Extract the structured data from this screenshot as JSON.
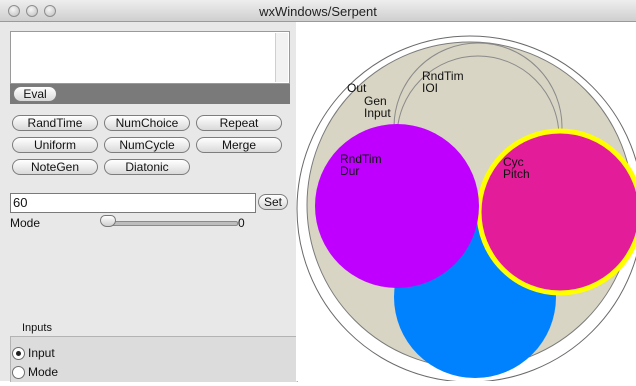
{
  "window": {
    "title": "wxWindows/Serpent"
  },
  "console": {
    "eval_label": "Eval"
  },
  "buttons": [
    {
      "label": "RandTime"
    },
    {
      "label": "NumChoice"
    },
    {
      "label": "Repeat"
    },
    {
      "label": "Uniform"
    },
    {
      "label": "NumCycle"
    },
    {
      "label": "Merge"
    },
    {
      "label": "NoteGen"
    },
    {
      "label": "Diatonic"
    }
  ],
  "entry": {
    "value": "60",
    "set_label": "Set"
  },
  "mode_slider": {
    "label": "Mode",
    "value": "0",
    "fraction": 0.0
  },
  "inputs_group": {
    "title": "Inputs",
    "options": [
      {
        "label": "Input",
        "selected": true
      },
      {
        "label": "Mode",
        "selected": false
      }
    ]
  },
  "canvas": {
    "colors": {
      "outer": "#ffffff",
      "out": "#d8d5c4",
      "randtim_dur": "#c000ff",
      "cyc_pitch": "#e31c9a",
      "cyc_pitch_ring": "#ffff00",
      "blue": "#0082ff"
    },
    "labels": {
      "out": "Out",
      "gen_input_1": "Gen",
      "gen_input_2": "Input",
      "randtim_ioi_1": "RndTim",
      "randtim_ioi_2": "IOI",
      "randtim_dur_1": "RndTim",
      "randtim_dur_2": "Dur",
      "cyc_pitch_1": "Cyc",
      "cyc_pitch_2": "Pitch"
    }
  }
}
